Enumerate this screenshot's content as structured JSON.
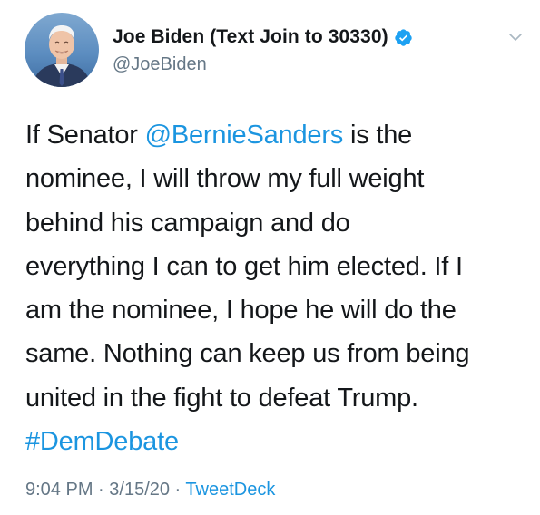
{
  "author": {
    "display_name": "Joe Biden (Text Join to 30330)",
    "handle": "@JoeBiden",
    "verified": true,
    "verified_icon": "verified-badge-icon",
    "menu_icon": "chevron-down-icon"
  },
  "tweet": {
    "lines": [
      {
        "before": "If Senator ",
        "link": "@BernieSanders",
        "after": " is the"
      },
      {
        "before": "nominee, I will throw my full weight",
        "link": "",
        "after": ""
      },
      {
        "before": "behind his campaign and do",
        "link": "",
        "after": ""
      },
      {
        "before": "everything I can to get him elected. If I",
        "link": "",
        "after": ""
      },
      {
        "before": "am the nominee, I hope he will do the",
        "link": "",
        "after": ""
      },
      {
        "before": "same. Nothing can keep us from being",
        "link": "",
        "after": ""
      },
      {
        "before": "united in the fight to defeat Trump.",
        "link": "",
        "after": ""
      },
      {
        "before": "",
        "link": "#DemDebate",
        "after": ""
      }
    ]
  },
  "meta": {
    "time": "9:04 PM",
    "sep1": " · ",
    "date": "3/15/20",
    "sep2": " · ",
    "source": "TweetDeck"
  },
  "colors": {
    "link": "#1b95e0",
    "text": "#14171a",
    "muted": "#657786",
    "verified": "#1da1f2"
  }
}
